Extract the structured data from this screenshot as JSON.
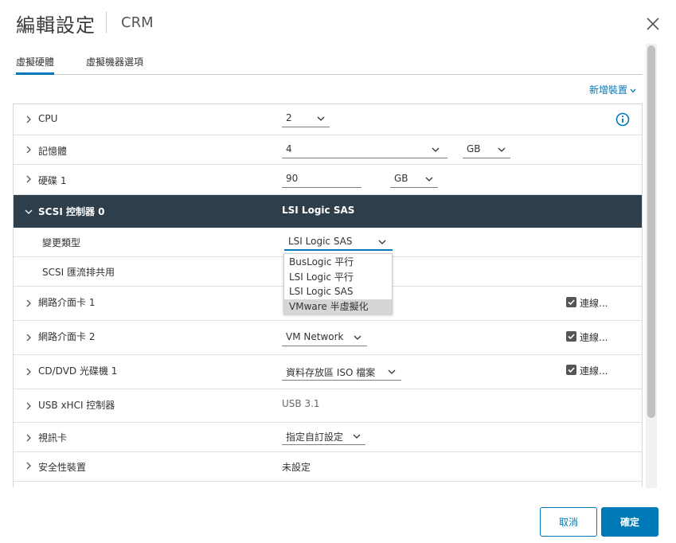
{
  "header": {
    "title": "編輯設定",
    "subtitle": "CRM"
  },
  "tabs": [
    {
      "label": "虛擬硬體",
      "active": true
    },
    {
      "label": "虛擬機器選項",
      "active": false
    }
  ],
  "add_device": {
    "label": "新增裝置"
  },
  "rows": {
    "cpu": {
      "label": "CPU",
      "value": "2"
    },
    "memory": {
      "label": "記憶體",
      "value": "4",
      "unit": "GB"
    },
    "disk1": {
      "label": "硬碟 1",
      "value": "90",
      "unit": "GB"
    },
    "scsi": {
      "label": "SCSI 控制器 0",
      "value": "LSI Logic SAS"
    },
    "change_type": {
      "label": "變更類型",
      "value": "LSI Logic SAS"
    },
    "scsi_bus_sharing": {
      "label": "SCSI 匯流排共用"
    },
    "nic1": {
      "label": "網路介面卡 1",
      "connect_label": "連線..."
    },
    "nic2": {
      "label": "網路介面卡 2",
      "value": "VM Network",
      "connect_label": "連線..."
    },
    "cddvd": {
      "label": "CD/DVD 光碟機 1",
      "value": "資料存放區 ISO 檔案",
      "connect_label": "連線..."
    },
    "usb": {
      "label": "USB xHCI 控制器",
      "value": "USB 3.1"
    },
    "video": {
      "label": "視訊卡",
      "value": "指定自訂設定"
    },
    "security": {
      "label": "安全性裝置",
      "value": "未設定"
    }
  },
  "dropdown_options": [
    "BusLogic 平行",
    "LSI Logic 平行",
    "LSI Logic SAS",
    "VMware 半虛擬化"
  ],
  "dropdown_highlighted_index": 3,
  "footer": {
    "cancel": "取消",
    "ok": "確定"
  },
  "colors": {
    "accent": "#0079b8",
    "header_row_bg": "#2e3e4a"
  }
}
